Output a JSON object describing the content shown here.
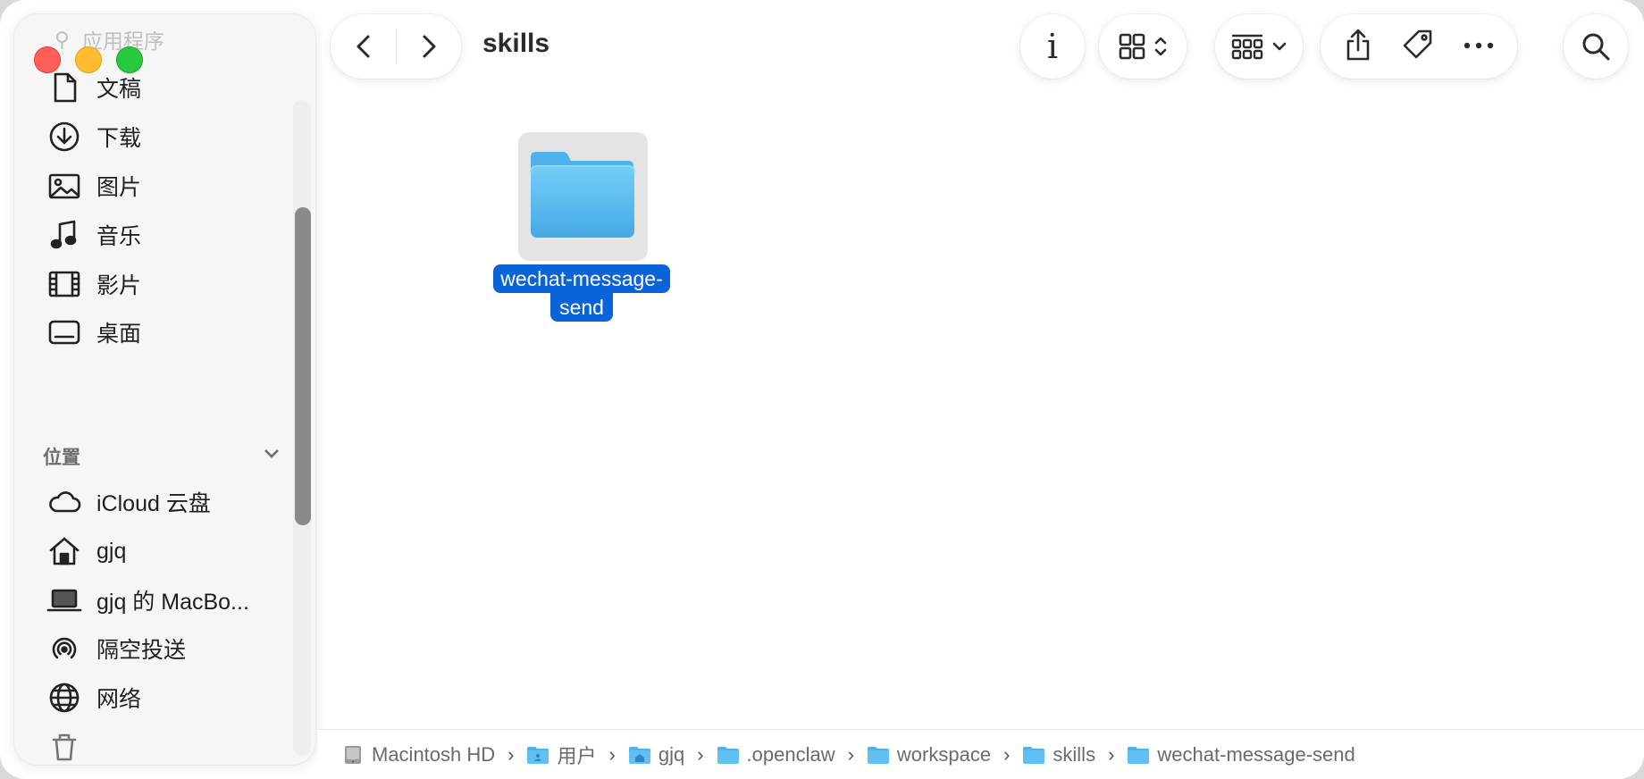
{
  "window": {
    "title": "skills"
  },
  "sidebar": {
    "faded_top_label": "应用程序",
    "favorites": [
      {
        "label": "文稿",
        "icon": "document-icon"
      },
      {
        "label": "下载",
        "icon": "download-icon"
      },
      {
        "label": "图片",
        "icon": "photo-icon"
      },
      {
        "label": "音乐",
        "icon": "music-icon"
      },
      {
        "label": "影片",
        "icon": "film-icon"
      },
      {
        "label": "桌面",
        "icon": "desktop-icon"
      }
    ],
    "locations_header": "位置",
    "locations": [
      {
        "label": "iCloud 云盘",
        "icon": "cloud-icon"
      },
      {
        "label": "gjq",
        "icon": "home-icon"
      },
      {
        "label": "gjq 的 MacBo...",
        "icon": "laptop-icon"
      },
      {
        "label": "隔空投送",
        "icon": "airdrop-icon"
      },
      {
        "label": "网络",
        "icon": "globe-icon"
      }
    ]
  },
  "toolbar": {
    "info_label": "i"
  },
  "content": {
    "items": [
      {
        "name_line1": "wechat-message-",
        "name_line2": "send",
        "selected": true,
        "color": "#5bb8f0"
      }
    ]
  },
  "pathbar": {
    "crumbs": [
      {
        "label": "Macintosh HD",
        "icon": "disk-icon"
      },
      {
        "label": "用户",
        "icon": "users-folder-icon"
      },
      {
        "label": "gjq",
        "icon": "home-folder-icon"
      },
      {
        "label": ".openclaw",
        "icon": "folder-icon"
      },
      {
        "label": "workspace",
        "icon": "folder-icon"
      },
      {
        "label": "skills",
        "icon": "folder-icon"
      },
      {
        "label": "wechat-message-send",
        "icon": "folder-icon"
      }
    ]
  },
  "colors": {
    "selection": "#0a63d9",
    "folder": "#5bb8f0",
    "close": "#ff5f57",
    "minimize": "#febc2e",
    "zoom": "#28c840"
  }
}
